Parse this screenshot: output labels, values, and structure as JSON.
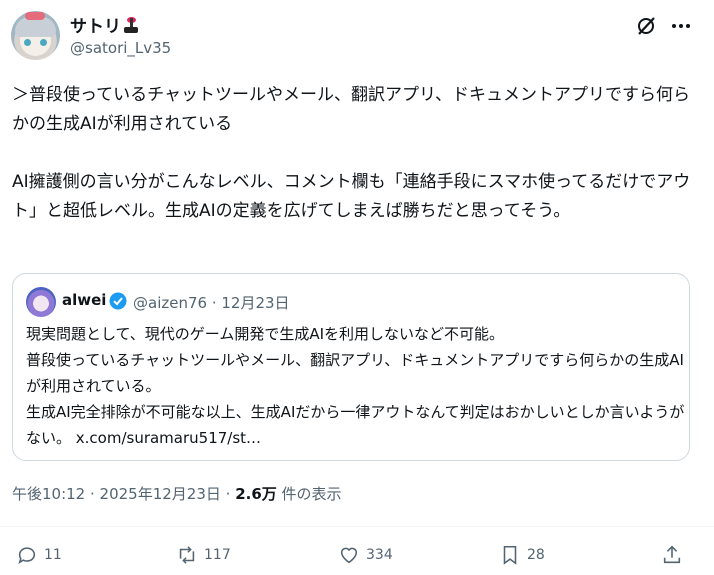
{
  "author": {
    "display_name": "サトリ",
    "handle": "@satori_Lv35"
  },
  "post": {
    "text": "＞普段使っているチャットツールやメール、翻訳アプリ、ドキュメントアプリですら何らかの生成AIが利用されている\n\nAI擁護側の言い分がこんなレベル、コメント欄も「連絡手段にスマホ使ってるだけでアウト」と超低レベル。生成AIの定義を広げてしまえば勝ちだと思ってそう。"
  },
  "quote": {
    "display_name": "alwei",
    "handle_date": "@aizen76 · 12月23日",
    "text": "現実問題として、現代のゲーム開発で生成AIを利用しないなど不可能。\n普段使っているチャットツールやメール、翻訳アプリ、ドキュメントアプリですら何らかの生成AIが利用されている。\n生成AI完全排除が不可能な以上、生成AIだから一律アウトなんて判定はおかしいとしか言いようがない。 x.com/suramaru517/st…"
  },
  "meta": {
    "timestamp": "午後10:12 · 2025年12月23日 · ",
    "views": "2.6万",
    "views_suffix": " 件の表示"
  },
  "actions": {
    "replies": "11",
    "reposts": "117",
    "likes": "334",
    "bookmarks": "28"
  },
  "icons": {
    "grok": "grok-icon",
    "more": "more-icon",
    "reply": "reply-icon",
    "repost": "repost-icon",
    "like": "like-icon",
    "bookmark": "bookmark-icon",
    "share": "share-icon",
    "verified": "verified-icon"
  },
  "colors": {
    "text": "#0f1419",
    "muted": "#536471",
    "verified": "#1d9bf0",
    "border": "#cfd9de"
  }
}
